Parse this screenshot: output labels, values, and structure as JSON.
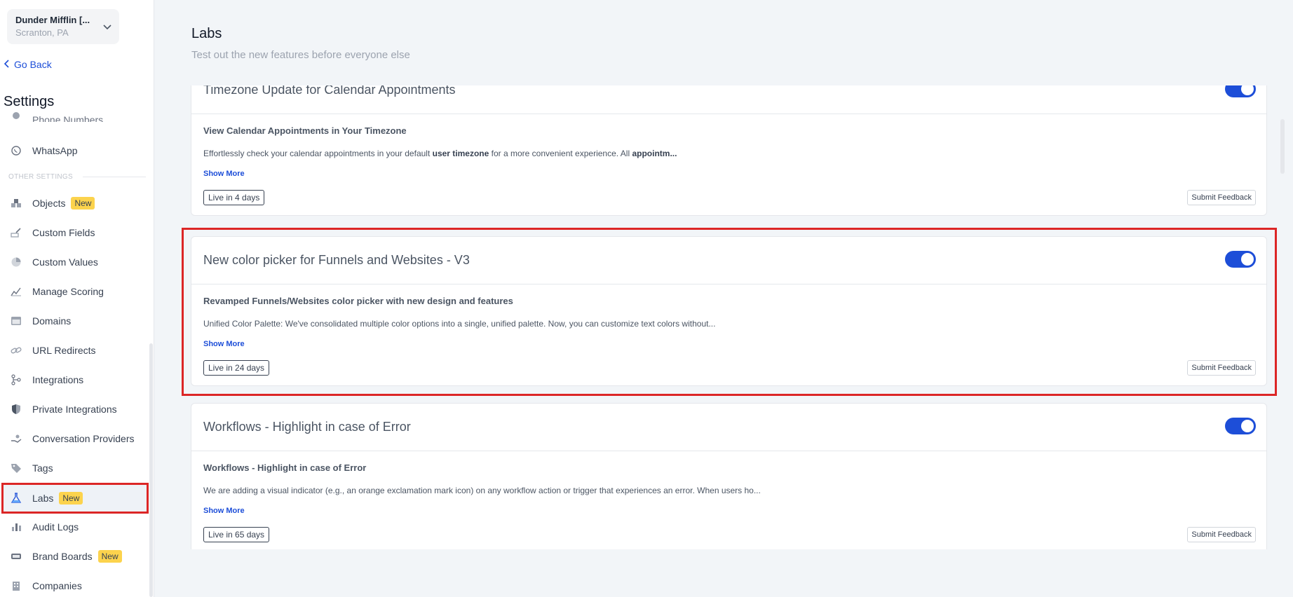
{
  "account": {
    "name": "Dunder Mifflin [...",
    "location": "Scranton, PA"
  },
  "nav": {
    "go_back": "Go Back",
    "settings_title": "Settings",
    "partial_item": "Phone Numbers",
    "whatsapp": "WhatsApp",
    "section_other": "OTHER SETTINGS",
    "objects": "Objects",
    "custom_fields": "Custom Fields",
    "custom_values": "Custom Values",
    "manage_scoring": "Manage Scoring",
    "domains": "Domains",
    "url_redirects": "URL Redirects",
    "integrations": "Integrations",
    "private_integrations": "Private Integrations",
    "conversation_providers": "Conversation Providers",
    "tags": "Tags",
    "labs": "Labs",
    "audit_logs": "Audit Logs",
    "brand_boards": "Brand Boards",
    "companies": "Companies",
    "new_badge": "New"
  },
  "page": {
    "title": "Labs",
    "subtitle": "Test out the new features before everyone else"
  },
  "cards": [
    {
      "title": "Timezone Update for Calendar Appointments",
      "subtitle": "View Calendar Appointments in Your Timezone",
      "desc_1": "Effortlessly check your calendar appointments in your default ",
      "desc_bold_1": "user timezone",
      "desc_2": " for a more convenient experience. All ",
      "desc_bold_2": "appointm...",
      "show_more": "Show More",
      "live": "Live in 4 days",
      "feedback": "Submit Feedback",
      "enabled": true
    },
    {
      "title": "New color picker for Funnels and Websites - V3",
      "subtitle": "Revamped Funnels/Websites color picker with new design and features",
      "desc": "Unified Color Palette: We've consolidated multiple color options into a single, unified palette. Now, you can customize text colors without...",
      "show_more": "Show More",
      "live": "Live in 24 days",
      "feedback": "Submit Feedback",
      "enabled": true
    },
    {
      "title": "Workflows - Highlight in case of Error",
      "subtitle": "Workflows - Highlight in case of Error",
      "desc": "We are adding a visual indicator (e.g., an orange exclamation mark icon) on any workflow action or trigger that experiences an error. When users ho...",
      "show_more": "Show More",
      "live": "Live in 65 days",
      "feedback": "Submit Feedback",
      "enabled": true
    }
  ],
  "colors": {
    "accent": "#1d4ed8",
    "highlight": "#dc2626",
    "badge": "#fcd34d"
  }
}
